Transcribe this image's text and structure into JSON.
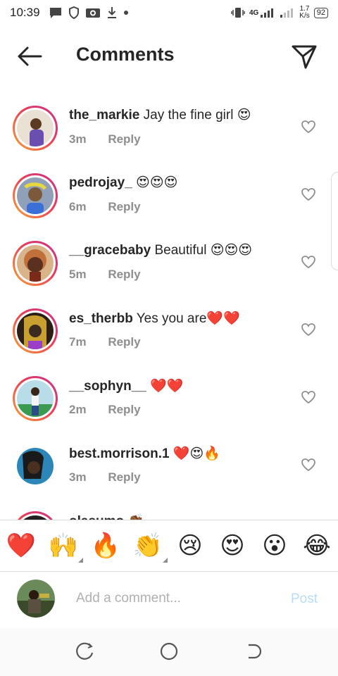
{
  "status_bar": {
    "time": "10:39",
    "network": "4G",
    "speed_value": "1.7",
    "speed_unit": "K/s",
    "battery": "92"
  },
  "header": {
    "title": "Comments",
    "back_icon": "arrow-left-icon",
    "send_icon": "paper-plane-icon"
  },
  "comments": [
    {
      "username": "the_markie",
      "text": "Jay the fine girl 😍",
      "time": "3m",
      "reply_label": "Reply",
      "avatar_color": "#6b4fb0"
    },
    {
      "username": "pedrojay_",
      "text": "😍😍😍",
      "time": "6m",
      "reply_label": "Reply",
      "avatar_color": "#7a5a3a"
    },
    {
      "username": "__gracebaby",
      "text": "Beautiful 😍😍😍",
      "time": "5m",
      "reply_label": "Reply",
      "avatar_color": "#c0703a"
    },
    {
      "username": "es_therbb",
      "text": "Yes you are❤️❤️",
      "time": "7m",
      "reply_label": "Reply",
      "avatar_color": "#3a2a20"
    },
    {
      "username": "__sophyn__",
      "text": "❤️❤️",
      "time": "2m",
      "reply_label": "Reply",
      "avatar_color": "#6fb0c8"
    },
    {
      "username": "best.morrison.1",
      "text": "❤️😍🔥",
      "time": "3m",
      "reply_label": "Reply",
      "avatar_color": "#2c86b8"
    },
    {
      "username": "olasumo",
      "text": "👏🏾",
      "time": "",
      "reply_label": "",
      "avatar_color": "#222222"
    }
  ],
  "emoji_bar": [
    "❤️",
    "🙌",
    "🔥",
    "👏",
    "😢",
    "😍",
    "😮",
    "😂"
  ],
  "composer": {
    "placeholder": "Add a comment...",
    "post_label": "Post"
  },
  "colors": {
    "accent_blue_disabled": "#b8dcfa",
    "story_ring_start": "#f9a435",
    "story_ring_end": "#c43490",
    "secondary_text": "#8e8e8e"
  }
}
